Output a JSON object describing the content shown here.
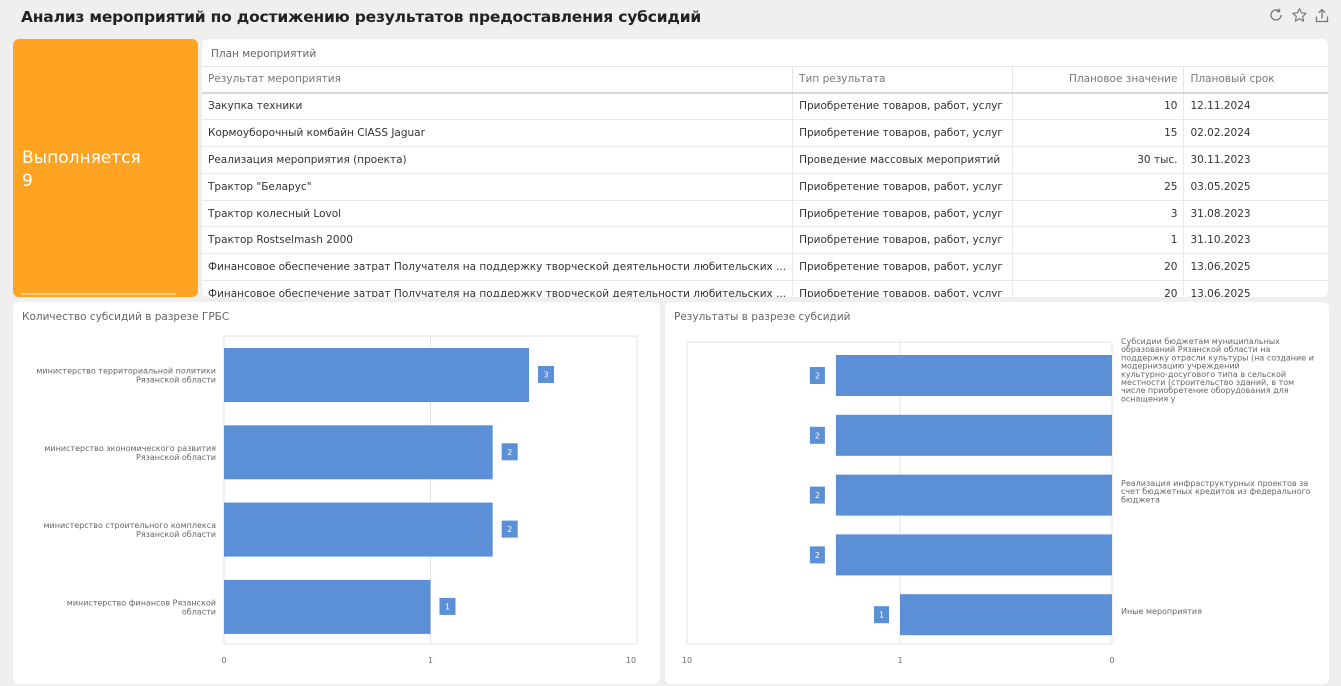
{
  "header": {
    "title": "Анализ мероприятий по достижению результатов предоставления субсидий",
    "icons": [
      "refresh-icon",
      "star-icon",
      "share-icon"
    ]
  },
  "kpi": {
    "label": "Выполняется",
    "value": "9",
    "color": "#ffa322"
  },
  "plan_table": {
    "title": "План мероприятий",
    "columns": [
      "Результат мероприятия",
      "Тип результата",
      "Плановое значение",
      "Плановый срок"
    ],
    "rows": [
      [
        "Закупка техники",
        "Приобретение товаров, работ, услуг",
        "10",
        "12.11.2024"
      ],
      [
        "Кормоуборочный комбайн ClASS Jaguar",
        "Приобретение товаров, работ, услуг",
        "15",
        "02.02.2024"
      ],
      [
        "Реализация мероприятия (проекта)",
        "Проведение массовых мероприятий",
        "30 тыс.",
        "30.11.2023"
      ],
      [
        "Трактор \"Беларус\"",
        "Приобретение товаров, работ, услуг",
        "25",
        "03.05.2025"
      ],
      [
        "Трактор колесный Lovol",
        "Приобретение товаров, работ, услуг",
        "3",
        "31.08.2023"
      ],
      [
        "Трактор Rostselmash 2000",
        "Приобретение товаров, работ, услуг",
        "1",
        "31.10.2023"
      ],
      [
        "Финансовое обеспечение затрат Получателя на поддержку творческой деятельности любительских ...",
        "Приобретение товаров, работ, услуг",
        "20",
        "13.06.2025"
      ],
      [
        "Финансовое обеспечение затрат Получателя на поддержку творческой деятельности любительских ...",
        "Приобретение товаров, работ, услуг",
        "20",
        "13.06.2025"
      ]
    ]
  },
  "chart_data": [
    {
      "type": "bar",
      "orientation": "horizontal",
      "title": "Количество субсидий в разрезе ГРБС",
      "categories": [
        [
          "министерство территориальной политики",
          "Рязанской области"
        ],
        [
          "министерство экономического развития",
          "Рязанской области"
        ],
        [
          "министерство строительного комплекса",
          "Рязанской области"
        ],
        [
          "министерство финансов Рязанской",
          "области"
        ]
      ],
      "values": [
        3,
        2,
        2,
        1
      ],
      "x_ticks": [
        "0",
        "1",
        "10"
      ],
      "x_scale": "log",
      "color": "#5b8fd6"
    },
    {
      "type": "bar",
      "orientation": "horizontal",
      "title": "Результаты в разрезе субсидий",
      "categories": [
        [
          "Субсидии бюджетам муниципальных",
          "образований Рязанской области на",
          "поддержку отрасли культуры (на создание и",
          "модернизацию учреждений",
          "культурно-досугового типа в сельской",
          "местности (строительство зданий, в том",
          "числе приобретение оборудования для",
          "оснащения у"
        ],
        [],
        [
          "Реализация инфраструктурных проектов за",
          "счет бюджетных кредитов из федерального",
          "бюджета"
        ],
        [],
        [
          "Иные мероприятия"
        ]
      ],
      "values": [
        2,
        2,
        2,
        2,
        1
      ],
      "x_ticks": [
        "10",
        "1",
        "0"
      ],
      "x_scale": "log",
      "reversed": true,
      "color": "#5b8fd6"
    }
  ]
}
